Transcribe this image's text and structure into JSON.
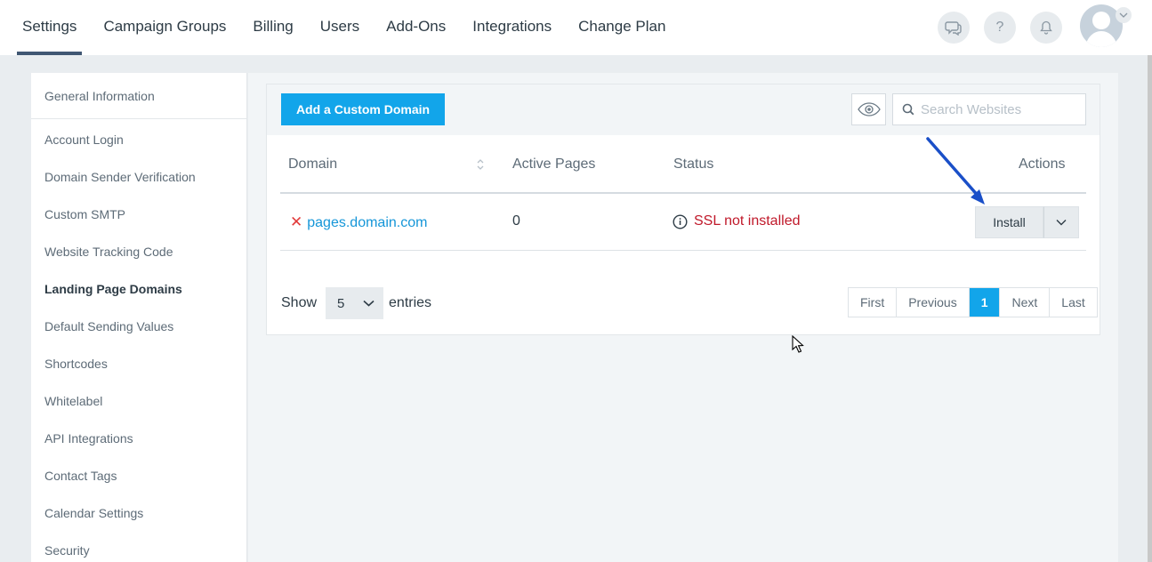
{
  "nav": {
    "tabs": [
      {
        "label": "Settings"
      },
      {
        "label": "Campaign Groups"
      },
      {
        "label": "Billing"
      },
      {
        "label": "Users"
      },
      {
        "label": "Add-Ons"
      },
      {
        "label": "Integrations"
      },
      {
        "label": "Change Plan"
      }
    ],
    "icons": [
      "chat-icon",
      "help-icon",
      "bell-icon"
    ],
    "help_glyph": "?"
  },
  "sidebar": {
    "items": [
      {
        "label": "General Information"
      },
      {
        "label": "Account Login"
      },
      {
        "label": "Domain Sender Verification"
      },
      {
        "label": "Custom SMTP"
      },
      {
        "label": "Website Tracking Code"
      },
      {
        "label": "Landing Page Domains"
      },
      {
        "label": "Default Sending Values"
      },
      {
        "label": "Shortcodes"
      },
      {
        "label": "Whitelabel"
      },
      {
        "label": "API Integrations"
      },
      {
        "label": "Contact Tags"
      },
      {
        "label": "Calendar Settings"
      },
      {
        "label": "Security"
      }
    ],
    "active": "Landing Page Domains"
  },
  "toolbar": {
    "add_label": "Add a Custom Domain",
    "search_placeholder": "Search Websites"
  },
  "table": {
    "headers": {
      "domain": "Domain",
      "active_pages": "Active Pages",
      "status": "Status",
      "actions": "Actions"
    },
    "rows": [
      {
        "domain": "pages.domain.com",
        "active_pages": "0",
        "status": "SSL not installed",
        "action": "Install"
      }
    ]
  },
  "footer": {
    "show_label": "Show",
    "entries_value": "5",
    "entries_label": "entries",
    "pager": {
      "first": "First",
      "previous": "Previous",
      "current": "1",
      "next": "Next",
      "last": "Last"
    }
  },
  "colors": {
    "accent": "#12a5ea",
    "error": "#c0192a",
    "link": "#1596d8",
    "arrow": "#1a4fc8"
  }
}
